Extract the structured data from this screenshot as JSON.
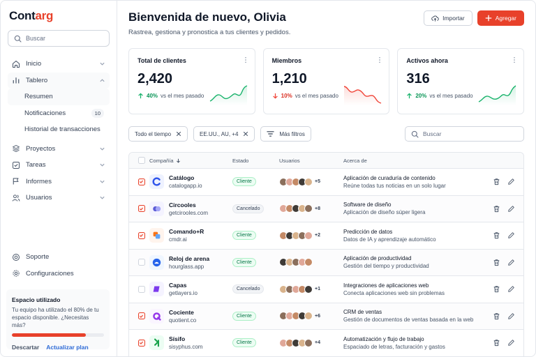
{
  "brand": {
    "name_pre": "Cont",
    "name_accent": "arg"
  },
  "sidebar": {
    "search_placeholder": "Buscar",
    "nav": {
      "home": "Inicio",
      "dashboard": "Tablero",
      "sub": {
        "summary": "Resumen",
        "notifications": "Notificaciones",
        "notifications_count": "10",
        "history": "Historial de transacciones"
      },
      "projects": "Proyectos",
      "tasks": "Tareas",
      "reports": "Informes",
      "users": "Usuarios"
    },
    "support": "Soporte",
    "settings": "Configuraciones",
    "storage": {
      "title": "Espacio utilizado",
      "desc": "Tu equipo ha utilizado el 80% de tu espacio disponible. ¿Necesitas más?",
      "used_fraction": 0.8,
      "dismiss": "Descartar",
      "upgrade": "Actualizar plan"
    }
  },
  "header": {
    "title": "Bienvenida de nuevo, Olivia",
    "subtitle": "Rastrea, gestiona y pronostica a tus clientes y pedidos.",
    "import_label": "Importar",
    "add_label": "Agregar"
  },
  "metrics": [
    {
      "title": "Total de clientes",
      "value": "2,420",
      "change": "40%",
      "direction": "up",
      "note": "vs el mes pasado"
    },
    {
      "title": "Miembros",
      "value": "1,210",
      "change": "10%",
      "direction": "down",
      "note": "vs el mes pasado"
    },
    {
      "title": "Activos ahora",
      "value": "316",
      "change": "20%",
      "direction": "up",
      "note": "vs el mes pasado"
    }
  ],
  "filters": {
    "time": "Todo el tiempo",
    "region": "EE.UU., AU, +4",
    "more": "Más filtros",
    "search_placeholder": "Buscar"
  },
  "table": {
    "headers": {
      "company": "Compañía",
      "status": "Estado",
      "users": "Usuarios",
      "about": "Acerca de"
    },
    "rows": [
      {
        "name": "Catálogo",
        "site": "catalogapp.io",
        "status": "Cliente",
        "more": "+5",
        "about_title": "Aplicación de curaduría de contenido",
        "about_sub": "Reúne todas tus noticias en un solo lugar",
        "checked": true
      },
      {
        "name": "Circooles",
        "site": "getcirooles.com",
        "status": "Cancelado",
        "more": "+8",
        "about_title": "Software de diseño",
        "about_sub": "Aplicación de diseño súper ligera",
        "checked": true
      },
      {
        "name": "Comando+R",
        "site": "cmdr.ai",
        "status": "Cliente",
        "more": "+2",
        "about_title": "Predicción de datos",
        "about_sub": "Datos de IA y aprendizaje automático",
        "checked": true
      },
      {
        "name": "Reloj de arena",
        "site": "hourglass.app",
        "status": "Cliente",
        "more": "",
        "about_title": "Aplicación de productividad",
        "about_sub": "Gestión del tiempo y productividad",
        "checked": false
      },
      {
        "name": "Capas",
        "site": "getlayers.io",
        "status": "Cancelado",
        "more": "+1",
        "about_title": "Integraciones de aplicaciones web",
        "about_sub": "Conecta aplicaciones web sin problemas",
        "checked": false
      },
      {
        "name": "Cociente",
        "site": "quotient.co",
        "status": "Cliente",
        "more": "+6",
        "about_title": "CRM de ventas",
        "about_sub": "Gestión de documentos de ventas basada en la web",
        "checked": true
      },
      {
        "name": "Sísifo",
        "site": "sisyphus.com",
        "status": "Cliente",
        "more": "+4",
        "about_title": "Automatización y flujo de trabajo",
        "about_sub": "Espaciado de letras, facturación y gastos",
        "checked": true
      }
    ]
  },
  "colors": {
    "accent": "#e8412a",
    "up": "#17b26a",
    "down": "#f04438"
  }
}
